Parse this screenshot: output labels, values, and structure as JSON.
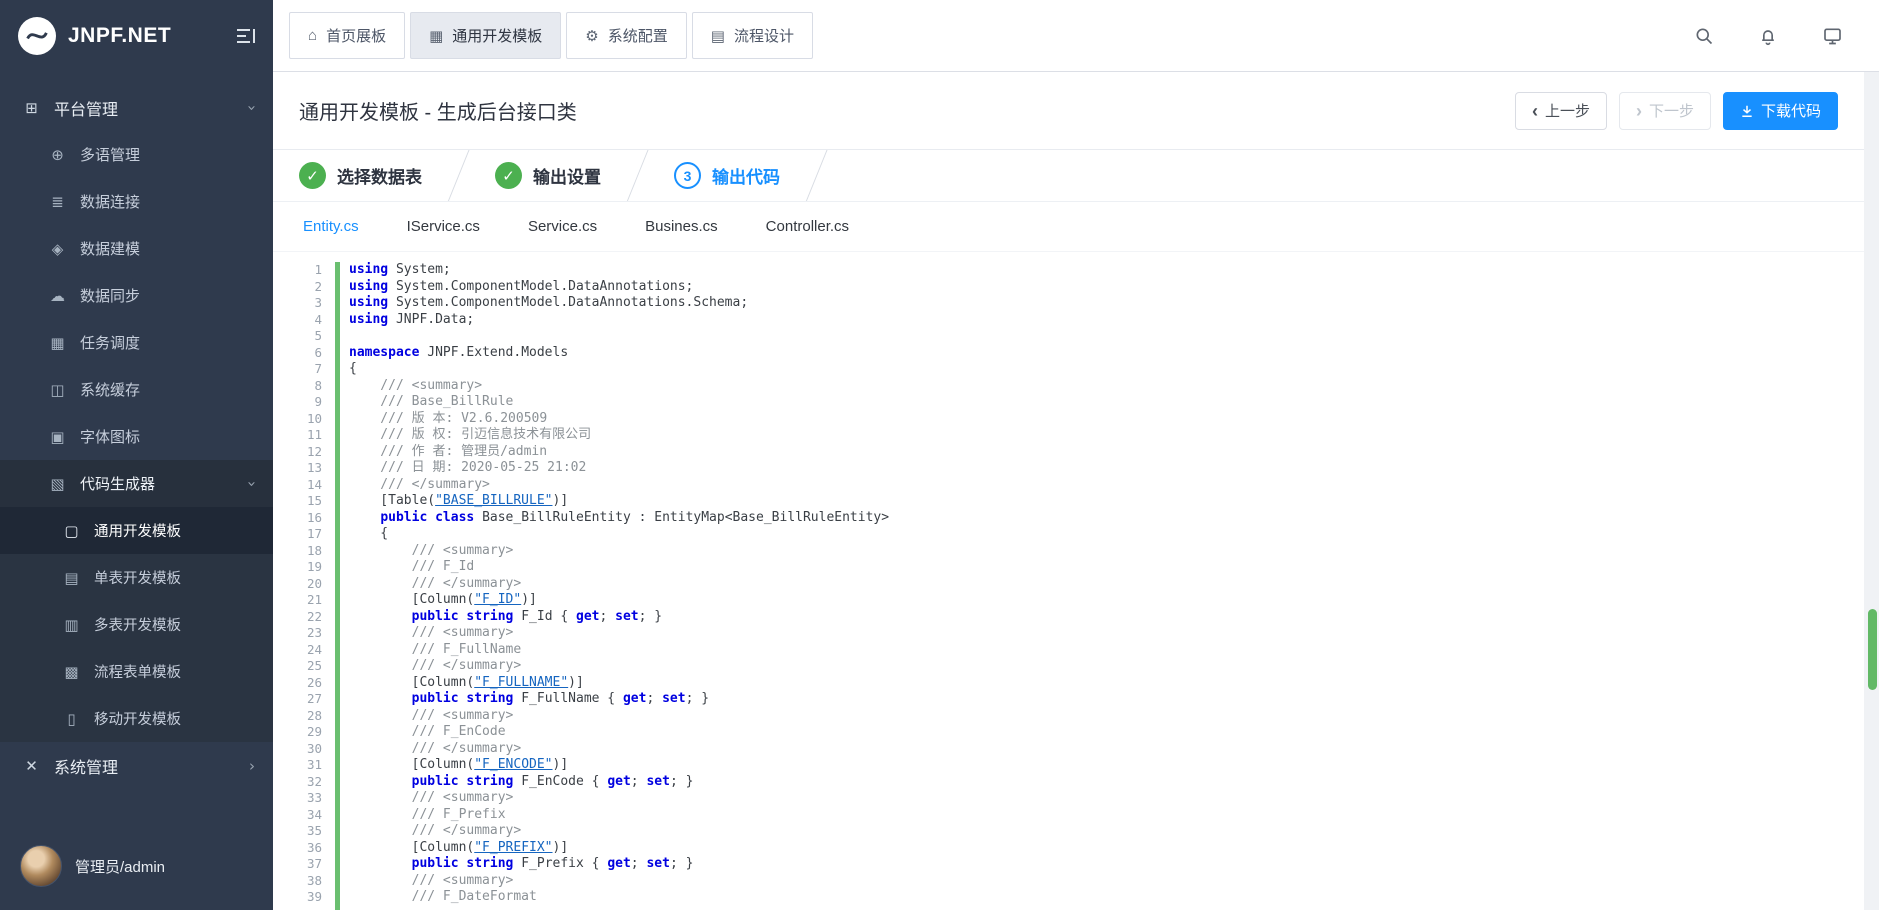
{
  "app": {
    "brand": "JNPF.NET"
  },
  "colors": {
    "accent": "#1890ff",
    "green": "#4cb050",
    "sidebar_bg": "#2f3a4d"
  },
  "sidebar": {
    "menu": [
      {
        "label": "平台管理",
        "name": "platform-management",
        "glyph": "⊞",
        "level": 0,
        "chevron": "down"
      },
      {
        "label": "多语管理",
        "name": "multi-language",
        "glyph": "⊕",
        "level": 1
      },
      {
        "label": "数据连接",
        "name": "data-connection",
        "glyph": "≣",
        "level": 1
      },
      {
        "label": "数据建模",
        "name": "data-modeling",
        "glyph": "◈",
        "level": 1
      },
      {
        "label": "数据同步",
        "name": "data-sync",
        "glyph": "☁",
        "level": 1
      },
      {
        "label": "任务调度",
        "name": "task-scheduler",
        "glyph": "▦",
        "level": 1
      },
      {
        "label": "系统缓存",
        "name": "system-cache",
        "glyph": "◫",
        "level": 1
      },
      {
        "label": "字体图标",
        "name": "font-icons",
        "glyph": "▣",
        "level": 1
      },
      {
        "label": "代码生成器",
        "name": "code-generator",
        "glyph": "▧",
        "level": 1,
        "chevron": "down",
        "open": true
      },
      {
        "label": "通用开发模板",
        "name": "general-dev-template",
        "glyph": "▢",
        "level": 2,
        "active": true
      },
      {
        "label": "单表开发模板",
        "name": "single-table-template",
        "glyph": "▤",
        "level": 2
      },
      {
        "label": "多表开发模板",
        "name": "multi-table-template",
        "glyph": "▥",
        "level": 2
      },
      {
        "label": "流程表单模板",
        "name": "flow-form-template",
        "glyph": "▩",
        "level": 2
      },
      {
        "label": "移动开发模板",
        "name": "mobile-dev-template",
        "glyph": "▯",
        "level": 2
      },
      {
        "label": "系统管理",
        "name": "system-management",
        "glyph": "✕",
        "level": 0,
        "chevron": "right"
      }
    ],
    "user": "管理员/admin"
  },
  "topbar": {
    "tabs": [
      {
        "label": "首页展板",
        "name": "home-dashboard",
        "glyph": "⌂"
      },
      {
        "label": "通用开发模板",
        "name": "general-dev-template",
        "glyph": "▦",
        "active": true
      },
      {
        "label": "系统配置",
        "name": "system-config",
        "glyph": "⚙"
      },
      {
        "label": "流程设计",
        "name": "flow-design",
        "glyph": "▤"
      }
    ]
  },
  "page": {
    "title": "通用开发模板 - 生成后台接口类",
    "prev_label": "上一步",
    "next_label": "下一步",
    "download_label": "下载代码"
  },
  "steps": [
    {
      "label": "选择数据表",
      "state": "done"
    },
    {
      "label": "输出设置",
      "state": "done"
    },
    {
      "label": "输出代码",
      "state": "active",
      "num": "3"
    }
  ],
  "code_tabs": [
    {
      "label": "Entity.cs",
      "active": true
    },
    {
      "label": "IService.cs"
    },
    {
      "label": "Service.cs"
    },
    {
      "label": "Busines.cs"
    },
    {
      "label": "Controller.cs"
    }
  ],
  "code": {
    "lines": [
      [
        [
          "kw",
          "using"
        ],
        [
          "pl",
          " System;"
        ]
      ],
      [
        [
          "kw",
          "using"
        ],
        [
          "pl",
          " System.ComponentModel.DataAnnotations;"
        ]
      ],
      [
        [
          "kw",
          "using"
        ],
        [
          "pl",
          " System.ComponentModel.DataAnnotations.Schema;"
        ]
      ],
      [
        [
          "kw",
          "using"
        ],
        [
          "pl",
          " JNPF.Data;"
        ]
      ],
      [],
      [
        [
          "kw",
          "namespace"
        ],
        [
          "pl",
          " JNPF.Extend.Models"
        ]
      ],
      [
        [
          "pl",
          "{"
        ]
      ],
      [
        [
          "cm",
          "    /// <summary>"
        ]
      ],
      [
        [
          "cm",
          "    /// Base_BillRule"
        ]
      ],
      [
        [
          "cm",
          "    /// 版 本: V2.6.200509"
        ]
      ],
      [
        [
          "cm",
          "    /// 版 权: 引迈信息技术有限公司"
        ]
      ],
      [
        [
          "cm",
          "    /// 作 者: 管理员/admin"
        ]
      ],
      [
        [
          "cm",
          "    /// 日 期: 2020-05-25 21:02"
        ]
      ],
      [
        [
          "cm",
          "    /// </summary>"
        ]
      ],
      [
        [
          "pl",
          "    [Table("
        ],
        [
          "str",
          "\"BASE_BILLRULE\""
        ],
        [
          "pl",
          ")]"
        ]
      ],
      [
        [
          "pl",
          "    "
        ],
        [
          "kw",
          "public"
        ],
        [
          "pl",
          " "
        ],
        [
          "kw",
          "class"
        ],
        [
          "pl",
          " Base_BillRuleEntity : EntityMap<Base_BillRuleEntity>"
        ]
      ],
      [
        [
          "pl",
          "    {"
        ]
      ],
      [
        [
          "cm",
          "        /// <summary>"
        ]
      ],
      [
        [
          "cm",
          "        /// F_Id"
        ]
      ],
      [
        [
          "cm",
          "        /// </summary>"
        ]
      ],
      [
        [
          "pl",
          "        [Column("
        ],
        [
          "str",
          "\"F_ID\""
        ],
        [
          "pl",
          ")]"
        ]
      ],
      [
        [
          "pl",
          "        "
        ],
        [
          "kw",
          "public"
        ],
        [
          "pl",
          " "
        ],
        [
          "kw",
          "string"
        ],
        [
          "pl",
          " F_Id { "
        ],
        [
          "kw",
          "get"
        ],
        [
          "pl",
          "; "
        ],
        [
          "kw",
          "set"
        ],
        [
          "pl",
          "; }"
        ]
      ],
      [
        [
          "cm",
          "        /// <summary>"
        ]
      ],
      [
        [
          "cm",
          "        /// F_FullName"
        ]
      ],
      [
        [
          "cm",
          "        /// </summary>"
        ]
      ],
      [
        [
          "pl",
          "        [Column("
        ],
        [
          "str",
          "\"F_FULLNAME\""
        ],
        [
          "pl",
          ")]"
        ]
      ],
      [
        [
          "pl",
          "        "
        ],
        [
          "kw",
          "public"
        ],
        [
          "pl",
          " "
        ],
        [
          "kw",
          "string"
        ],
        [
          "pl",
          " F_FullName { "
        ],
        [
          "kw",
          "get"
        ],
        [
          "pl",
          "; "
        ],
        [
          "kw",
          "set"
        ],
        [
          "pl",
          "; }"
        ]
      ],
      [
        [
          "cm",
          "        /// <summary>"
        ]
      ],
      [
        [
          "cm",
          "        /// F_EnCode"
        ]
      ],
      [
        [
          "cm",
          "        /// </summary>"
        ]
      ],
      [
        [
          "pl",
          "        [Column("
        ],
        [
          "str",
          "\"F_ENCODE\""
        ],
        [
          "pl",
          ")]"
        ]
      ],
      [
        [
          "pl",
          "        "
        ],
        [
          "kw",
          "public"
        ],
        [
          "pl",
          " "
        ],
        [
          "kw",
          "string"
        ],
        [
          "pl",
          " F_EnCode { "
        ],
        [
          "kw",
          "get"
        ],
        [
          "pl",
          "; "
        ],
        [
          "kw",
          "set"
        ],
        [
          "pl",
          "; }"
        ]
      ],
      [
        [
          "cm",
          "        /// <summary>"
        ]
      ],
      [
        [
          "cm",
          "        /// F_Prefix"
        ]
      ],
      [
        [
          "cm",
          "        /// </summary>"
        ]
      ],
      [
        [
          "pl",
          "        [Column("
        ],
        [
          "str",
          "\"F_PREFIX\""
        ],
        [
          "pl",
          ")]"
        ]
      ],
      [
        [
          "pl",
          "        "
        ],
        [
          "kw",
          "public"
        ],
        [
          "pl",
          " "
        ],
        [
          "kw",
          "string"
        ],
        [
          "pl",
          " F_Prefix { "
        ],
        [
          "kw",
          "get"
        ],
        [
          "pl",
          "; "
        ],
        [
          "kw",
          "set"
        ],
        [
          "pl",
          "; }"
        ]
      ],
      [
        [
          "cm",
          "        /// <summary>"
        ]
      ],
      [
        [
          "cm",
          "        /// F_DateFormat"
        ]
      ]
    ]
  }
}
